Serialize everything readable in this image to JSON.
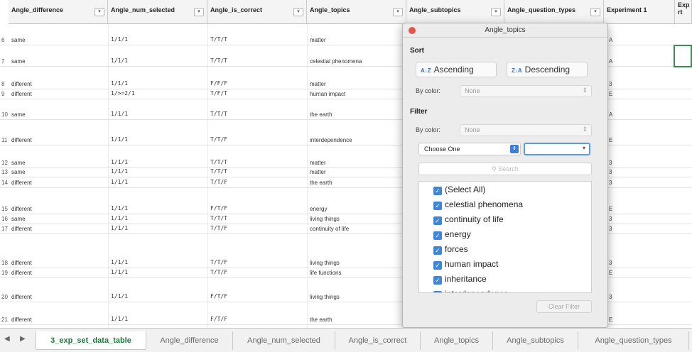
{
  "columns": [
    {
      "key": "angle_difference",
      "label": "Angle_difference",
      "filter_icon": "filter-arrow-icon"
    },
    {
      "key": "angle_num_selected",
      "label": "Angle_num_selected",
      "filter_icon": "filter-arrow-icon"
    },
    {
      "key": "angle_is_correct",
      "label": "Angle_is_correct",
      "filter_icon": "filter-arrow-icon"
    },
    {
      "key": "angle_topics",
      "label": "Angle_topics",
      "filter_icon": "filter-arrow-icon"
    },
    {
      "key": "angle_subtopics",
      "label": "Angle_subtopics",
      "filter_icon": "filter-arrow-icon"
    },
    {
      "key": "angle_question_types",
      "label": "Angle_question_types",
      "filter_icon": "filter-arrow-icon"
    },
    {
      "key": "experiment_1",
      "label": "Experiment 1"
    },
    {
      "key": "exp_cut",
      "label": "Exp\nrt"
    }
  ],
  "rows": [
    {
      "rn": "6",
      "diff": "same",
      "num": "1/1/1",
      "correct": "T/T/T",
      "topic": "matter",
      "edge": "A"
    },
    {
      "rn": "7",
      "diff": "same",
      "num": "1/1/1",
      "correct": "T/T/T",
      "topic": "celestial phenomena",
      "edge": "A"
    },
    {
      "rn": "8",
      "diff": "different",
      "num": "1/1/1",
      "correct": "F/F/F",
      "topic": "matter",
      "edge": "3"
    },
    {
      "rn": "9",
      "diff": "different",
      "num": "1/>=2/1",
      "correct": "T/F/T",
      "topic": "human impact",
      "edge": "E"
    },
    {
      "rn": "10",
      "diff": "same",
      "num": "1/1/1",
      "correct": "T/T/T",
      "topic": "the earth",
      "edge": "A"
    },
    {
      "rn": "11",
      "diff": "different",
      "num": "1/1/1",
      "correct": "T/T/F",
      "topic": "interdependence",
      "edge": "E"
    },
    {
      "rn": "12",
      "diff": "same",
      "num": "1/1/1",
      "correct": "T/T/T",
      "topic": "matter",
      "edge": "3"
    },
    {
      "rn": "13",
      "diff": "same",
      "num": "1/1/1",
      "correct": "T/T/T",
      "topic": "matter",
      "edge": "3"
    },
    {
      "rn": "14",
      "diff": "different",
      "num": "1/1/1",
      "correct": "T/T/F",
      "topic": "the earth",
      "edge": "3"
    },
    {
      "rn": "15",
      "diff": "different",
      "num": "1/1/1",
      "correct": "F/T/F",
      "topic": "energy",
      "edge": "E"
    },
    {
      "rn": "16",
      "diff": "same",
      "num": "1/1/1",
      "correct": "T/T/T",
      "topic": "living things",
      "edge": "3"
    },
    {
      "rn": "17",
      "diff": "different",
      "num": "1/1/1",
      "correct": "T/T/F",
      "topic": "continuity of life",
      "edge": "3"
    },
    {
      "rn": "18",
      "diff": "different",
      "num": "1/1/1",
      "correct": "T/T/F",
      "topic": "living things",
      "edge": "3"
    },
    {
      "rn": "19",
      "diff": "different",
      "num": "1/1/1",
      "correct": "T/T/F",
      "topic": "life functions",
      "edge": "E"
    },
    {
      "rn": "20",
      "diff": "different",
      "num": "1/1/1",
      "correct": "F/T/F",
      "topic": "living things",
      "edge": "3"
    },
    {
      "rn": "21",
      "diff": "different",
      "num": "1/1/1",
      "correct": "F/T/F",
      "topic": "the earth",
      "edge": "E"
    }
  ],
  "popup": {
    "title": "Angle_topics",
    "sort_heading": "Sort",
    "ascending": "Ascending",
    "ascending_icon": "A↓Z",
    "descending": "Descending",
    "descending_icon": "Z↓A",
    "by_color_label": "By color:",
    "by_color_value": "None",
    "filter_heading": "Filter",
    "filter_by_color_label": "By color:",
    "filter_by_color_value": "None",
    "choose_one": "Choose One",
    "search_placeholder": "Search",
    "items": [
      {
        "label": "(Select All)",
        "checked": true
      },
      {
        "label": "celestial phenomena",
        "checked": true
      },
      {
        "label": "continuity of life",
        "checked": true
      },
      {
        "label": "energy",
        "checked": true
      },
      {
        "label": "forces",
        "checked": true
      },
      {
        "label": "human impact",
        "checked": true
      },
      {
        "label": "inheritance",
        "checked": true
      },
      {
        "label": "interdependence",
        "checked": true
      }
    ],
    "clear_filter": "Clear Filter"
  },
  "tabs": [
    {
      "label": "3_exp_set_data_table",
      "active": true
    },
    {
      "label": "Angle_difference"
    },
    {
      "label": "Angle_num_selected"
    },
    {
      "label": "Angle_is_correct"
    },
    {
      "label": "Angle_topics"
    },
    {
      "label": "Angle_subtopics"
    },
    {
      "label": "Angle_question_types"
    }
  ],
  "nav": {
    "prev": "◀",
    "next": "▶"
  },
  "colors": {
    "accent_green": "#1e7a3a",
    "checkbox_blue": "#3f86d8",
    "close_red": "#e5534b"
  }
}
